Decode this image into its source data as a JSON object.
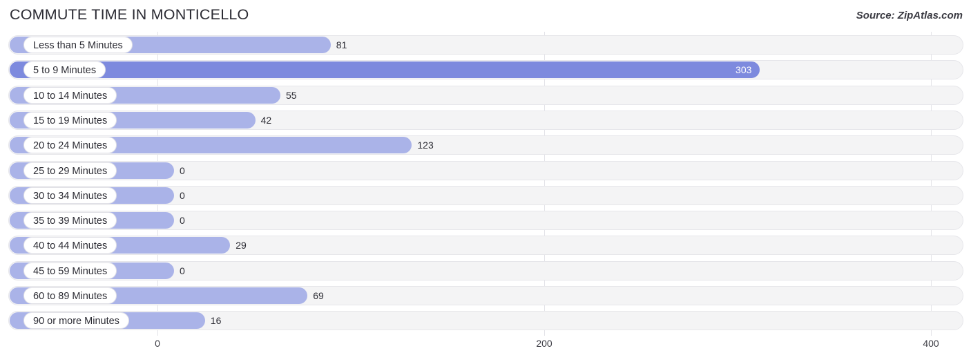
{
  "header": {
    "title": "COMMUTE TIME IN MONTICELLO",
    "source": "Source: ZipAtlas.com"
  },
  "colors": {
    "bar": "#aab3e8",
    "bar_highlight": "#7d8ade",
    "track": "#f4f4f5",
    "gridline": "#e3e3e8",
    "text": "#2b2b33"
  },
  "chart_data": {
    "type": "bar",
    "orientation": "horizontal",
    "title": "COMMUTE TIME IN MONTICELLO",
    "xlabel": "",
    "ylabel": "",
    "xlim": [
      0,
      400
    ],
    "grid": true,
    "legend": false,
    "xticks": [
      "0",
      "200",
      "400"
    ],
    "xtick_values": [
      0,
      200,
      400
    ],
    "categories": [
      "Less than 5 Minutes",
      "5 to 9 Minutes",
      "10 to 14 Minutes",
      "15 to 19 Minutes",
      "20 to 24 Minutes",
      "25 to 29 Minutes",
      "30 to 34 Minutes",
      "35 to 39 Minutes",
      "40 to 44 Minutes",
      "45 to 59 Minutes",
      "60 to 89 Minutes",
      "90 or more Minutes"
    ],
    "values": [
      81,
      303,
      55,
      42,
      123,
      0,
      0,
      0,
      29,
      0,
      69,
      16
    ],
    "value_labels": [
      "81",
      "303",
      "55",
      "42",
      "123",
      "0",
      "0",
      "0",
      "29",
      "0",
      "69",
      "16"
    ],
    "highlight_index": 1
  }
}
